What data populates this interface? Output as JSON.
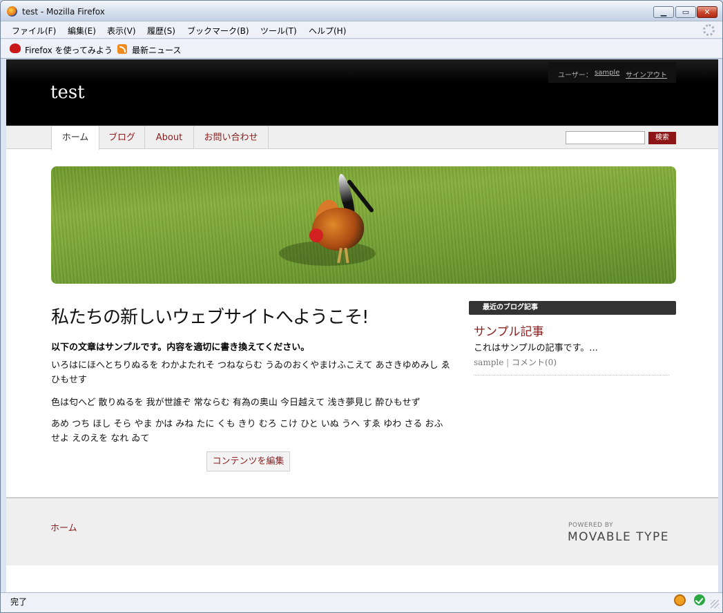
{
  "window": {
    "title": "test - Mozilla Firefox"
  },
  "menu": {
    "items": [
      "ファイル(F)",
      "編集(E)",
      "表示(V)",
      "履歴(S)",
      "ブックマーク(B)",
      "ツール(T)",
      "ヘルプ(H)"
    ]
  },
  "bookmarks": {
    "items": [
      "Firefox を使ってみよう",
      "最新ニュース"
    ]
  },
  "header": {
    "site_title": "test",
    "user_label": "ユーザー：",
    "user_name": "sample",
    "signout": "サインアウト"
  },
  "nav": {
    "tabs": [
      "ホーム",
      "ブログ",
      "About",
      "お問い合わせ"
    ],
    "search_button": "検索"
  },
  "main": {
    "title": "私たちの新しいウェブサイトへようこそ!",
    "lead": "以下の文章はサンプルです。内容を適切に書き換えてください。",
    "paragraphs": [
      "いろはにほへとちりぬるを わかよたれそ つねならむ うゐのおくやまけふこえて あさきゆめみし ゑひもせす",
      "色は匂へど 散りぬるを 我が世誰ぞ 常ならむ 有為の奥山 今日越えて 浅き夢見じ 酔ひもせず",
      "あめ つち ほし そら やま かは みね たに くも きり むろ こけ ひと いぬ うへ すゑ ゆわ さる おふ せよ えのえを なれ ゐて"
    ],
    "edit_button": "コンテンツを編集"
  },
  "sidebar": {
    "heading": "最近のブログ記事",
    "post_title": "サンプル記事",
    "post_excerpt": "これはサンプルの記事です。...",
    "post_author": "sample",
    "post_comments": "コメント(0)"
  },
  "footer": {
    "home_link": "ホーム",
    "powered_by": "POWERED BY",
    "logo_text": "MOVABLE TYPE"
  },
  "status": {
    "text": "完了"
  },
  "colors": {
    "accent": "#8a1c1c",
    "header_bg": "#000000"
  }
}
